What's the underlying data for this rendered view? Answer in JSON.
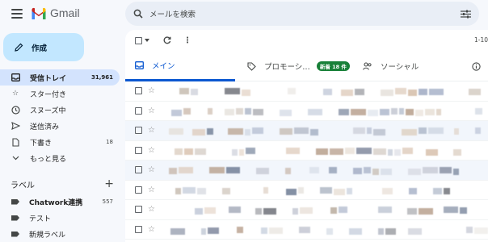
{
  "app": {
    "name": "Gmail"
  },
  "search": {
    "placeholder": "メールを検索"
  },
  "compose": {
    "label": "作成"
  },
  "nav": {
    "items": [
      {
        "label": "受信トレイ",
        "count": "31,961",
        "icon": "inbox-icon",
        "active": true
      },
      {
        "label": "スター付き",
        "count": "",
        "icon": "star-icon"
      },
      {
        "label": "スヌーズ中",
        "count": "",
        "icon": "clock-icon"
      },
      {
        "label": "送信済み",
        "count": "",
        "icon": "send-icon"
      },
      {
        "label": "下書き",
        "count": "18",
        "icon": "draft-icon"
      },
      {
        "label": "もっと見る",
        "count": "",
        "icon": "chevron-down-icon"
      }
    ]
  },
  "labels": {
    "title": "ラベル",
    "items": [
      {
        "label": "Chatwork連携",
        "count": "557"
      },
      {
        "label": "テスト",
        "count": ""
      },
      {
        "label": "新規ラベル",
        "count": ""
      }
    ]
  },
  "toolbar": {
    "pager": "1-10"
  },
  "tabs": [
    {
      "label": "メイン",
      "icon": "inbox-tab-icon",
      "active": true
    },
    {
      "label": "プロモーシ…",
      "icon": "tag-icon",
      "badge": "新着 18 件"
    },
    {
      "label": "ソーシャル",
      "icon": "people-icon"
    },
    {
      "label": "",
      "icon": "info-icon"
    }
  ],
  "colors": {
    "accent": "#0b57d0",
    "compose_bg": "#c2e7ff",
    "active_nav": "#d3e3fd",
    "badge": "#188038",
    "background": "#f6f8fc"
  }
}
